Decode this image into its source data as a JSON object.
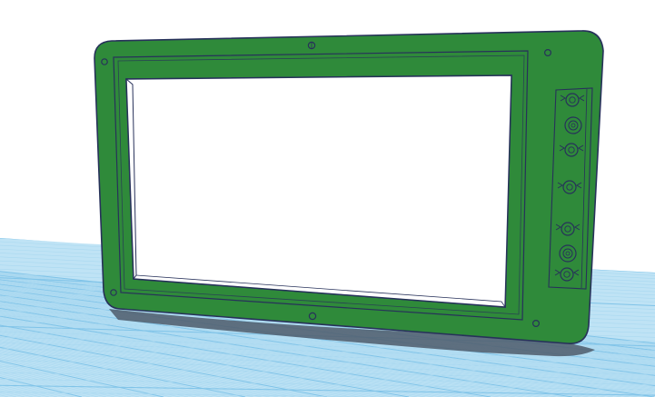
{
  "scene": {
    "background_color": "#ffffff",
    "grid_color": "#a9d8f0",
    "grid_major_color": "#7fc3e8",
    "grid_base_color": "#bfe3f5",
    "part_color": "#2f8a3a",
    "part_edge_color": "#27315a",
    "part_shadow_color": "#4f5c6b"
  },
  "model": {
    "mounting_holes": [
      "hole-top-left",
      "hole-top-right",
      "hole-top-center",
      "hole-bottom-left",
      "hole-bottom-right",
      "hole-bottom-center"
    ],
    "side_panel_components": [
      "connector-1",
      "encoder-1",
      "connector-2",
      "connector-3",
      "connector-4",
      "encoder-2",
      "connector-5"
    ]
  }
}
